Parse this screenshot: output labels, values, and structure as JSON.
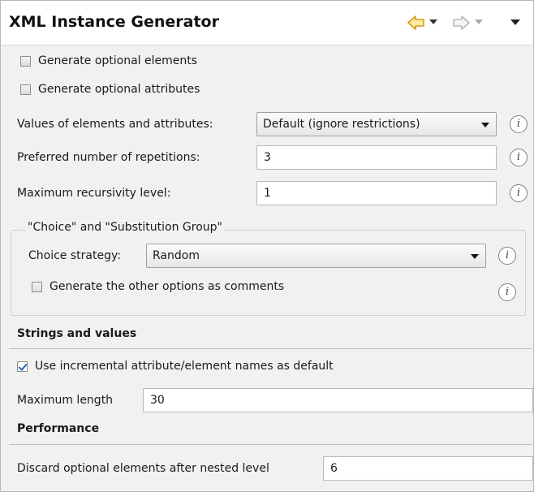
{
  "title": "XML Instance Generator",
  "nav": {
    "back_icon": "back-arrow-icon",
    "forward_icon": "forward-arrow-icon",
    "menu_icon": "view-menu-icon",
    "accent": "#e8a317"
  },
  "options": {
    "gen_optional_elements": "Generate optional elements",
    "gen_optional_attributes": "Generate optional attributes",
    "values_label": "Values of elements and attributes:",
    "values_selected": "Default (ignore restrictions)",
    "repetitions_label": "Preferred number of repetitions:",
    "repetitions_value": "3",
    "recursivity_label": "Maximum recursivity level:",
    "recursivity_value": "1"
  },
  "choice_group": {
    "title": "\"Choice\" and \"Substitution Group\"",
    "strategy_label": "Choice strategy:",
    "strategy_selected": "Random",
    "comments_label": "Generate the other options as comments"
  },
  "strings": {
    "header": "Strings and values",
    "incremental_label": "Use incremental attribute/element names as default",
    "incremental_checked": true,
    "max_length_label": "Maximum length",
    "max_length_value": "30"
  },
  "performance": {
    "header": "Performance",
    "discard_label": "Discard optional elements after nested level",
    "discard_value": "6"
  },
  "info_glyph": "i"
}
